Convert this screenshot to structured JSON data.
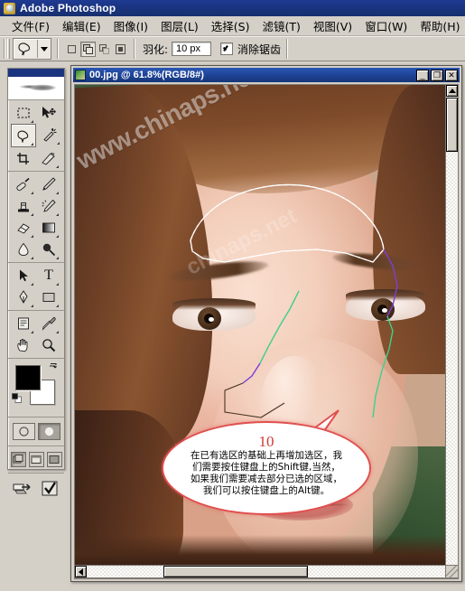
{
  "window": {
    "app_title": "Adobe Photoshop",
    "app_icon": "photoshop-icon"
  },
  "menubar": {
    "items": [
      {
        "label": "文件(F)",
        "name": "menu-file"
      },
      {
        "label": "编辑(E)",
        "name": "menu-edit"
      },
      {
        "label": "图像(I)",
        "name": "menu-image"
      },
      {
        "label": "图层(L)",
        "name": "menu-layer"
      },
      {
        "label": "选择(S)",
        "name": "menu-select"
      },
      {
        "label": "滤镜(T)",
        "name": "menu-filter"
      },
      {
        "label": "视图(V)",
        "name": "menu-view"
      },
      {
        "label": "窗口(W)",
        "name": "menu-window"
      },
      {
        "label": "帮助(H)",
        "name": "menu-help"
      }
    ]
  },
  "options_bar": {
    "active_tool_icon": "lasso-tool-icon",
    "preset_dropdown_icon": "chevron-down-icon",
    "selection_modes": [
      {
        "name": "new-selection-mode",
        "active": false
      },
      {
        "name": "add-to-selection-mode",
        "active": true
      },
      {
        "name": "subtract-from-selection-mode",
        "active": false
      },
      {
        "name": "intersect-selection-mode",
        "active": false
      }
    ],
    "feather_label": "羽化:",
    "feather_value": "10 px",
    "antialias_label": "消除锯齿",
    "antialias_checked": true
  },
  "toolbox": {
    "header_icon": "photoshop-feather-logo",
    "tools": [
      {
        "name": "rectangular-marquee-tool",
        "selected": false
      },
      {
        "name": "move-tool",
        "selected": false
      },
      {
        "name": "lasso-tool",
        "selected": true
      },
      {
        "name": "magic-wand-tool",
        "selected": false
      },
      {
        "name": "crop-tool",
        "selected": false
      },
      {
        "name": "slice-tool",
        "selected": false
      },
      {
        "name": "healing-brush-tool",
        "selected": false
      },
      {
        "name": "brush-tool",
        "selected": false
      },
      {
        "name": "clone-stamp-tool",
        "selected": false
      },
      {
        "name": "history-brush-tool",
        "selected": false
      },
      {
        "name": "eraser-tool",
        "selected": false
      },
      {
        "name": "gradient-tool",
        "selected": false
      },
      {
        "name": "blur-tool",
        "selected": false
      },
      {
        "name": "dodge-tool",
        "selected": false
      },
      {
        "name": "path-selection-tool",
        "selected": false
      },
      {
        "name": "type-tool",
        "selected": false
      },
      {
        "name": "pen-tool",
        "selected": false
      },
      {
        "name": "shape-tool",
        "selected": false
      },
      {
        "name": "notes-tool",
        "selected": false
      },
      {
        "name": "eyedropper-tool",
        "selected": false
      },
      {
        "name": "hand-tool",
        "selected": false
      },
      {
        "name": "zoom-tool",
        "selected": false
      }
    ],
    "type_tool_glyph": "T",
    "foreground_color": "#000000",
    "background_color": "#ffffff",
    "swap_colors_icon": "swap-colors-icon",
    "default_colors_icon": "default-colors-icon",
    "quick_mask": [
      {
        "name": "standard-mode-button",
        "active": false
      },
      {
        "name": "quick-mask-mode-button",
        "active": true
      }
    ],
    "screen_modes": [
      {
        "name": "standard-screen-mode-button",
        "active": true
      },
      {
        "name": "full-screen-menubar-mode-button",
        "active": false
      },
      {
        "name": "full-screen-mode-button",
        "active": false
      }
    ],
    "jump_buttons": [
      {
        "name": "jump-to-imageready-button"
      },
      {
        "name": "edit-in-imageready-button"
      }
    ]
  },
  "document": {
    "title": "00.jpg @ 61.8%(RGB/8#)",
    "thumbnail_icon": "document-thumbnail-icon",
    "window_buttons": [
      {
        "name": "minimize-button",
        "glyph": "_"
      },
      {
        "name": "maximize-button",
        "glyph": "❐"
      },
      {
        "name": "close-button",
        "glyph": "✕"
      }
    ],
    "zoom_percent": "61.8%",
    "color_mode": "RGB/8#",
    "filename": "00.jpg",
    "watermark": "www.chinaps.net",
    "watermark_2": "chinaps.net"
  },
  "annotation": {
    "number": "10",
    "lines": [
      "在已有选区的基础上再增加选区，我",
      "们需要按住键盘上的Shift键,当然，",
      "如果我们需要减去部分已选的区域，",
      "我们可以按住键盘上的Alt键。"
    ],
    "border_color": "#e0504f",
    "number_color": "#d03a38"
  },
  "scrollbars": {
    "vertical": {
      "name": "vertical-scrollbar",
      "up_icon": "triangle-up-icon",
      "down_icon": "triangle-down-icon"
    },
    "horizontal": {
      "name": "horizontal-scrollbar",
      "left_icon": "triangle-left-icon",
      "right_icon": "triangle-right-icon"
    }
  }
}
